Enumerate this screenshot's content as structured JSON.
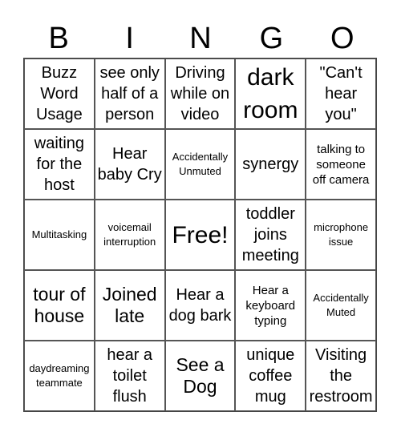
{
  "header": [
    "B",
    "I",
    "N",
    "G",
    "O"
  ],
  "cells": [
    {
      "text": "Buzz Word Usage",
      "size": "md"
    },
    {
      "text": "see only half of a person",
      "size": "md"
    },
    {
      "text": "Driving while on video",
      "size": "md"
    },
    {
      "text": "dark room",
      "size": "xl"
    },
    {
      "text": "\"Can't hear you\"",
      "size": "md"
    },
    {
      "text": "waiting for the host",
      "size": "md"
    },
    {
      "text": "Hear baby Cry",
      "size": "md"
    },
    {
      "text": "Accidentally Unmuted",
      "size": "xs"
    },
    {
      "text": "synergy",
      "size": "md"
    },
    {
      "text": "talking to someone off camera",
      "size": "sm"
    },
    {
      "text": "Multitasking",
      "size": "xs"
    },
    {
      "text": "voicemail interruption",
      "size": "xs"
    },
    {
      "text": "Free!",
      "size": "xl"
    },
    {
      "text": "toddler joins meeting",
      "size": "md"
    },
    {
      "text": "microphone issue",
      "size": "xs"
    },
    {
      "text": "tour of house",
      "size": "lg"
    },
    {
      "text": "Joined late",
      "size": "lg"
    },
    {
      "text": "Hear a dog bark",
      "size": "md"
    },
    {
      "text": "Hear a keyboard typing",
      "size": "sm"
    },
    {
      "text": "Accidentally Muted",
      "size": "xs"
    },
    {
      "text": "daydreaming teammate",
      "size": "xs"
    },
    {
      "text": "hear a toilet flush",
      "size": "md"
    },
    {
      "text": "See a Dog",
      "size": "lg"
    },
    {
      "text": "unique coffee mug",
      "size": "md"
    },
    {
      "text": "Visiting the restroom",
      "size": "md"
    }
  ]
}
